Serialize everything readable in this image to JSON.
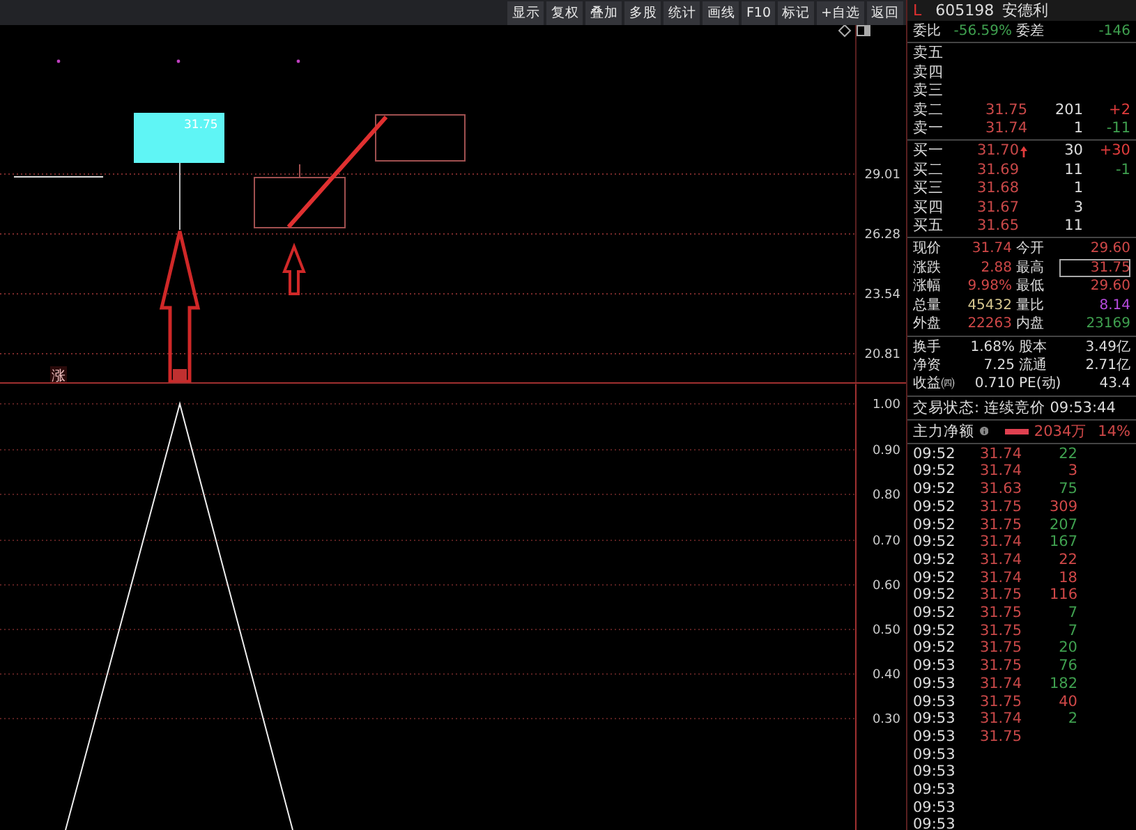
{
  "toolbar": [
    "显示",
    "复权",
    "叠加",
    "多股",
    "统计",
    "画线",
    "F10",
    "标记",
    "+自选",
    "返回"
  ],
  "chart": {
    "candle_label": "31.75",
    "signal_label": "涨",
    "price_axis": [
      "29.01",
      "26.28",
      "23.54",
      "20.81"
    ],
    "indicator_axis": [
      "1.00",
      "0.90",
      "0.80",
      "0.70",
      "0.60",
      "0.50",
      "0.40",
      "0.30"
    ]
  },
  "quote": {
    "market": "L",
    "code": "605198",
    "name": "安德利"
  },
  "order_ratio": {
    "label": "委比",
    "value": "-56.59%",
    "color": "#3fa04f",
    "diff_label": "委差",
    "diff_value": "-146"
  },
  "asks": [
    {
      "label": "卖五"
    },
    {
      "label": "卖四"
    },
    {
      "label": "卖三"
    },
    {
      "label": "卖二",
      "price": "31.75",
      "volume": "201",
      "change": "+2",
      "color": "#e03c3c"
    },
    {
      "label": "卖一",
      "price": "31.74",
      "volume": "1",
      "change": "-11",
      "color": "#3fa04f"
    }
  ],
  "bids": [
    {
      "label": "买一",
      "price": "31.70",
      "up_tick": true,
      "volume": "30",
      "change": "+30",
      "color": "#e03c3c"
    },
    {
      "label": "买二",
      "price": "31.69",
      "up_tick": false,
      "volume": "11",
      "change": "-1",
      "color": "#3fa04f"
    },
    {
      "label": "买三",
      "price": "31.68",
      "up_tick": false,
      "volume": "1"
    },
    {
      "label": "买四",
      "price": "31.67",
      "up_tick": false,
      "volume": "3"
    },
    {
      "label": "买五",
      "price": "31.65",
      "up_tick": false,
      "volume": "11"
    }
  ],
  "stats": [
    [
      {
        "label": "现价",
        "value": "31.74",
        "color": "#d04848",
        "highlighted": false
      },
      {
        "label": "今开",
        "value": "29.60",
        "color": "#d04848",
        "highlighted": false
      }
    ],
    [
      {
        "label": "涨跌",
        "value": "2.88",
        "color": "#d04848",
        "highlighted": false
      },
      {
        "label": "最高",
        "value": "31.75",
        "color": "#d04848",
        "highlighted": true
      }
    ],
    [
      {
        "label": "涨幅",
        "value": "9.98%",
        "color": "#d04848",
        "highlighted": false
      },
      {
        "label": "最低",
        "value": "29.60",
        "color": "#d04848",
        "highlighted": false
      }
    ],
    [
      {
        "label": "总量",
        "value": "45432",
        "color": "#d8c890",
        "highlighted": false
      },
      {
        "label": "量比",
        "value": "8.14",
        "color": "#b84ce0",
        "highlighted": false
      }
    ],
    [
      {
        "label": "外盘",
        "value": "22263",
        "color": "#d04848",
        "highlighted": false
      },
      {
        "label": "内盘",
        "value": "23169",
        "color": "#3fa04f",
        "highlighted": false
      }
    ]
  ],
  "fundamentals": [
    [
      {
        "label": "换手",
        "value": "1.68%"
      },
      {
        "label": "股本",
        "value": "3.49亿"
      }
    ],
    [
      {
        "label": "净资",
        "value": "7.25"
      },
      {
        "label": "流通",
        "value": "2.71亿"
      }
    ],
    [
      {
        "label": "收益㈣",
        "value": "0.710"
      },
      {
        "label": "PE(动)",
        "value": "43.4"
      }
    ]
  ],
  "trade_status": "交易状态: 连续竞价 09:53:44",
  "main_flow": {
    "label": "主力净额",
    "amount": "2034万",
    "percent": "14%"
  },
  "trades": [
    {
      "time": "09:52",
      "price": "31.74",
      "volume": "22",
      "color": "#3fa04f"
    },
    {
      "time": "09:52",
      "price": "31.74",
      "volume": "3",
      "color": "#d04848"
    },
    {
      "time": "09:52",
      "price": "31.63",
      "volume": "75",
      "color": "#3fa04f"
    },
    {
      "time": "09:52",
      "price": "31.75",
      "volume": "309",
      "color": "#d04848"
    },
    {
      "time": "09:52",
      "price": "31.75",
      "volume": "207",
      "color": "#3fa04f"
    },
    {
      "time": "09:52",
      "price": "31.74",
      "volume": "167",
      "color": "#3fa04f"
    },
    {
      "time": "09:52",
      "price": "31.74",
      "volume": "22",
      "color": "#d04848"
    },
    {
      "time": "09:52",
      "price": "31.74",
      "volume": "18",
      "color": "#d04848"
    },
    {
      "time": "09:52",
      "price": "31.75",
      "volume": "116",
      "color": "#d04848"
    },
    {
      "time": "09:52",
      "price": "31.75",
      "volume": "7",
      "color": "#3fa04f"
    },
    {
      "time": "09:52",
      "price": "31.75",
      "volume": "7",
      "color": "#3fa04f"
    },
    {
      "time": "09:52",
      "price": "31.75",
      "volume": "20",
      "color": "#3fa04f"
    },
    {
      "time": "09:53",
      "price": "31.75",
      "volume": "76",
      "color": "#3fa04f"
    },
    {
      "time": "09:53",
      "price": "31.74",
      "volume": "182",
      "color": "#3fa04f"
    },
    {
      "time": "09:53",
      "price": "31.75",
      "volume": "40",
      "color": "#d04848"
    },
    {
      "time": "09:53",
      "price": "31.74",
      "volume": "2",
      "color": "#3fa04f"
    },
    {
      "time": "09:53",
      "price": "31.75"
    },
    {
      "time": "09:53"
    },
    {
      "time": "09:53"
    },
    {
      "time": "09:53"
    },
    {
      "time": "09:53"
    },
    {
      "time": "09:53"
    }
  ]
}
